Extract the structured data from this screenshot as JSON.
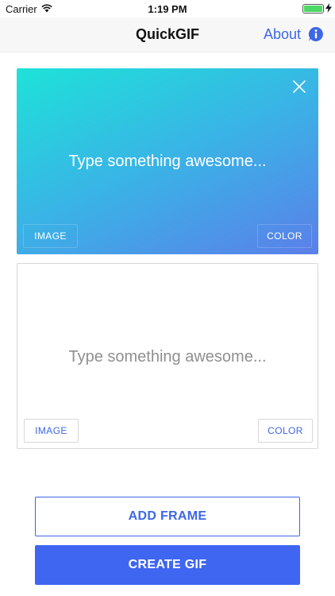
{
  "status_bar": {
    "carrier": "Carrier",
    "time": "1:19 PM",
    "battery_color": "#4cd964"
  },
  "nav": {
    "title": "QuickGIF",
    "about_label": "About",
    "info_icon": "info-icon"
  },
  "frames": [
    {
      "placeholder": "Type something awesome...",
      "image_label": "IMAGE",
      "color_label": "COLOR",
      "background": "gradient",
      "gradient_colors": [
        "#1ee2d8",
        "#5b7fe9"
      ],
      "has_close": true
    },
    {
      "placeholder": "Type something awesome...",
      "image_label": "IMAGE",
      "color_label": "COLOR",
      "background": "#ffffff"
    }
  ],
  "actions": {
    "add_frame_label": "ADD FRAME",
    "create_gif_label": "CREATE GIF"
  },
  "accent_color": "#3d67e6"
}
